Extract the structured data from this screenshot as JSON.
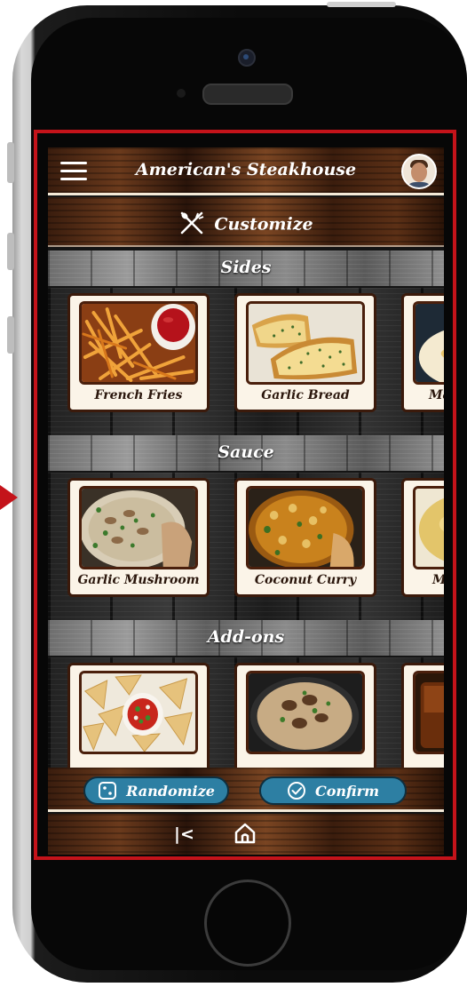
{
  "app": {
    "title": "American's Steakhouse"
  },
  "customize": {
    "label": "Customize"
  },
  "sections": [
    {
      "title": "Sides",
      "items": [
        {
          "name": "French Fries"
        },
        {
          "name": "Garlic Bread"
        },
        {
          "name": "Ma"
        }
      ]
    },
    {
      "title": "Sauce",
      "items": [
        {
          "name": "Garlic Mushroom"
        },
        {
          "name": "Coconut Curry"
        },
        {
          "name": "M"
        }
      ]
    },
    {
      "title": "Add-ons",
      "items": [
        {
          "name": ""
        },
        {
          "name": ""
        },
        {
          "name": ""
        }
      ]
    }
  ],
  "actions": {
    "randomize_label": "Randomize",
    "confirm_label": "Confirm"
  },
  "icons": {
    "menu": "menu-icon",
    "utensils": "utensils-icon",
    "dice": "dice-icon",
    "check": "check-circle-icon",
    "back": "back-icon",
    "home": "home-icon"
  },
  "colors": {
    "accent": "#2d7fa3",
    "frame": "#c4131a",
    "card": "#fbf4e8"
  }
}
